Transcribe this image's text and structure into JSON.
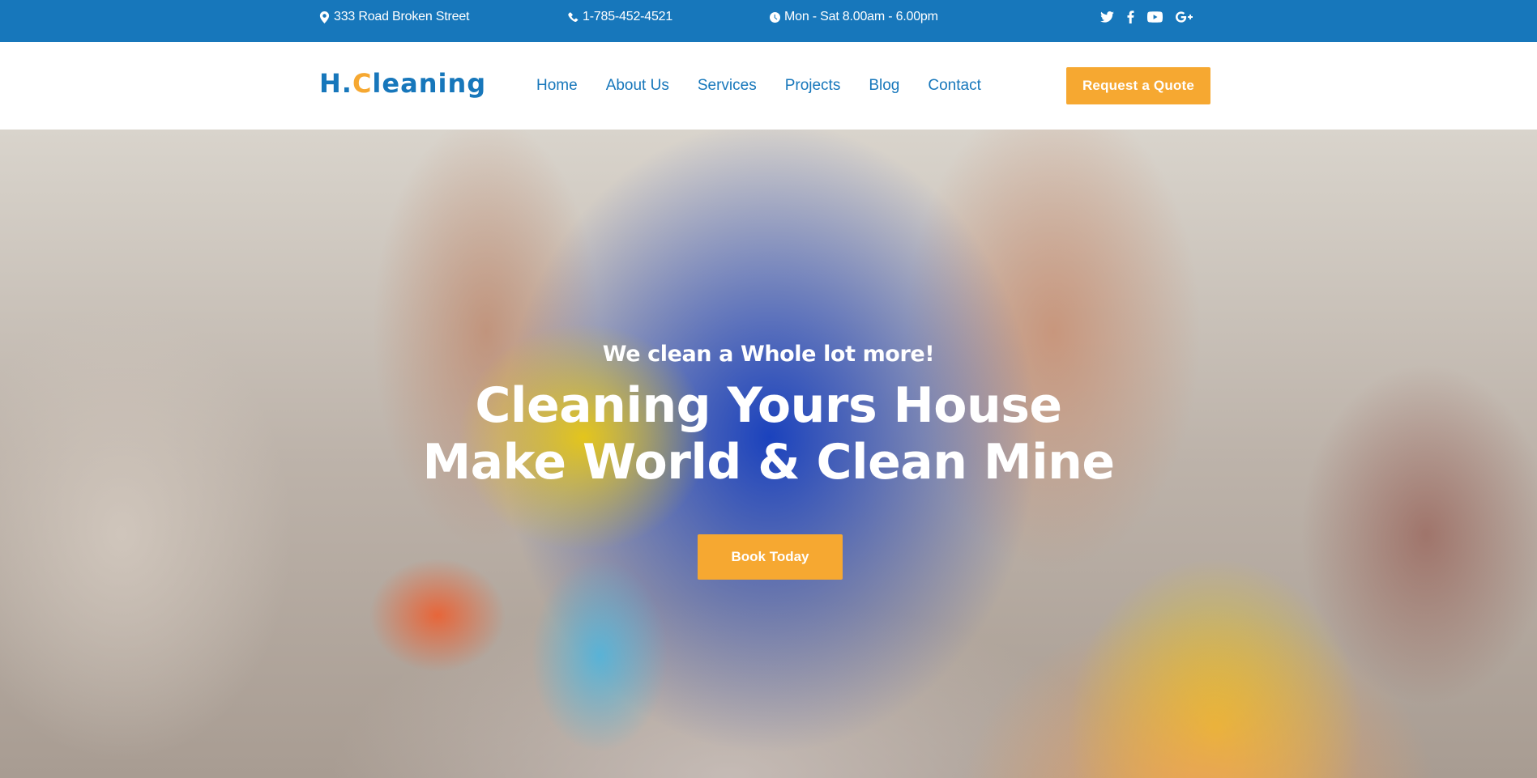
{
  "topbar": {
    "address": "333 Road Broken Street",
    "phone": "1-785-452-4521",
    "hours": "Mon - Sat 8.00am - 6.00pm",
    "social_icons": [
      "twitter-icon",
      "facebook-icon",
      "youtube-icon",
      "google-plus-icon"
    ]
  },
  "header": {
    "logo_prefix": "H.",
    "logo_accent": "C",
    "logo_suffix": "leaning",
    "nav": [
      "Home",
      "About Us",
      "Services",
      "Projects",
      "Blog",
      "Contact"
    ],
    "quote_button": "Request a Quote"
  },
  "hero": {
    "subtitle": "We clean a Whole lot more!",
    "title_line1": "Cleaning Yours House",
    "title_line2": "Make World & Clean Mine",
    "button": "Book Today"
  },
  "colors": {
    "primary": "#1777bb",
    "accent": "#f6a831"
  }
}
